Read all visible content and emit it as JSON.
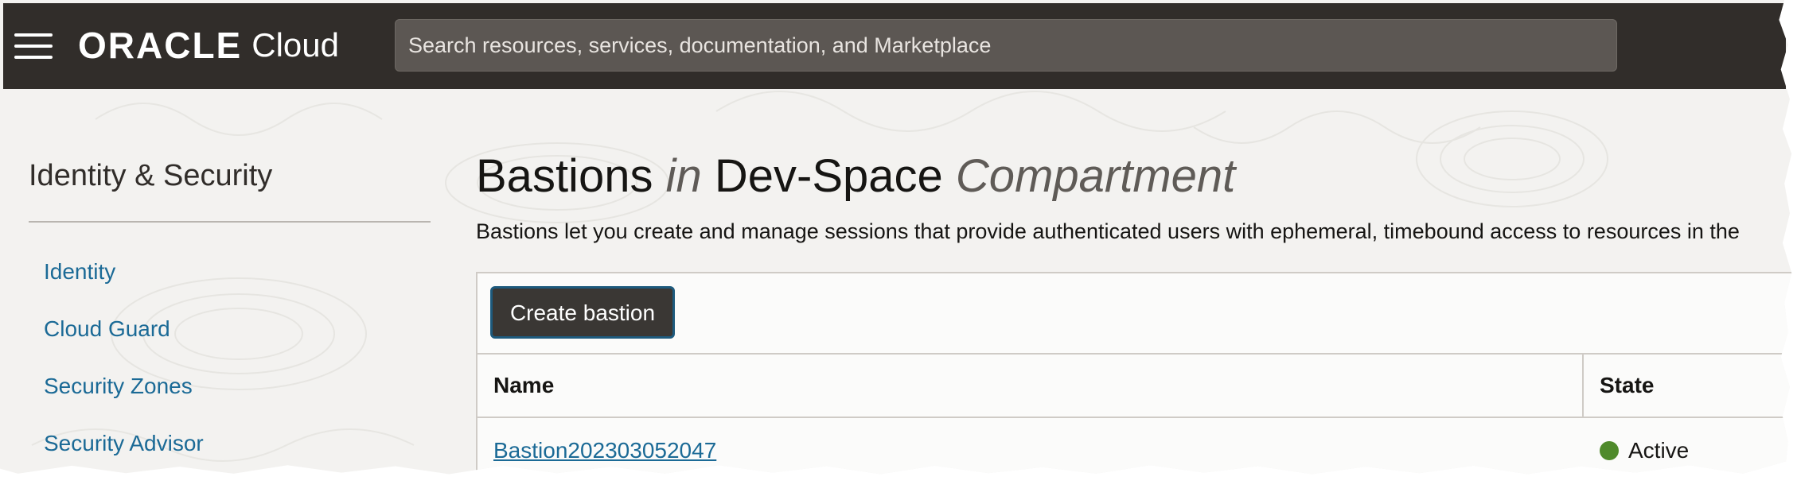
{
  "header": {
    "menu_icon": "hamburger-menu-icon",
    "brand_oracle": "ORACLE",
    "brand_cloud": "Cloud",
    "search_placeholder": "Search resources, services, documentation, and Marketplace"
  },
  "sidebar": {
    "title": "Identity & Security",
    "items": [
      {
        "label": "Identity"
      },
      {
        "label": "Cloud Guard"
      },
      {
        "label": "Security Zones"
      },
      {
        "label": "Security Advisor"
      }
    ]
  },
  "main": {
    "title_part1": "Bastions",
    "title_part2": "in",
    "title_part3": "Dev-Space",
    "title_part4": "Compartment",
    "description": "Bastions let you create and manage sessions that provide authenticated users with ephemeral, timebound access to resources in the",
    "create_button_label": "Create bastion",
    "table": {
      "columns": [
        "Name",
        "State"
      ],
      "rows": [
        {
          "name": "Bastion202303052047",
          "state": "Active",
          "state_color": "#4f8a2b"
        }
      ]
    }
  },
  "colors": {
    "header_bg": "#312d2a",
    "link": "#1b6a96",
    "button_bg": "#3a3734",
    "button_border": "#1d5a7d",
    "active_status": "#4f8a2b"
  }
}
